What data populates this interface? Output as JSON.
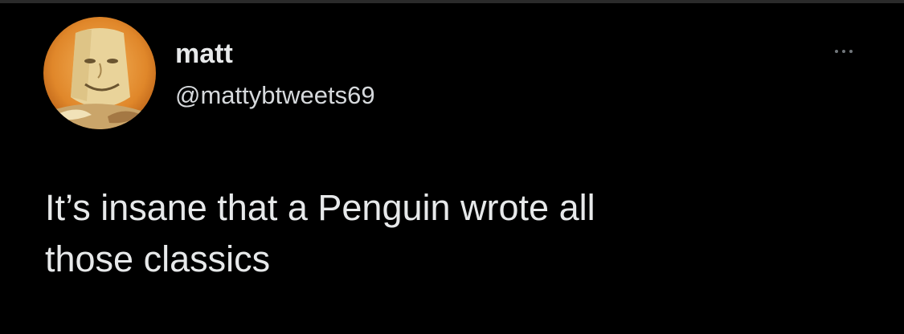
{
  "tweet": {
    "author": {
      "display_name": "matt",
      "handle": "@mattybtweets69",
      "avatar_icon": "avatar-photo"
    },
    "text": "It’s insane that a Penguin wrote all\nthose classics",
    "menu_icon": "more-options-icon"
  },
  "colors": {
    "background": "#000000",
    "text_primary": "#e7e9ea",
    "text_secondary": "#d6d9dc",
    "icon_muted": "#71767b"
  }
}
